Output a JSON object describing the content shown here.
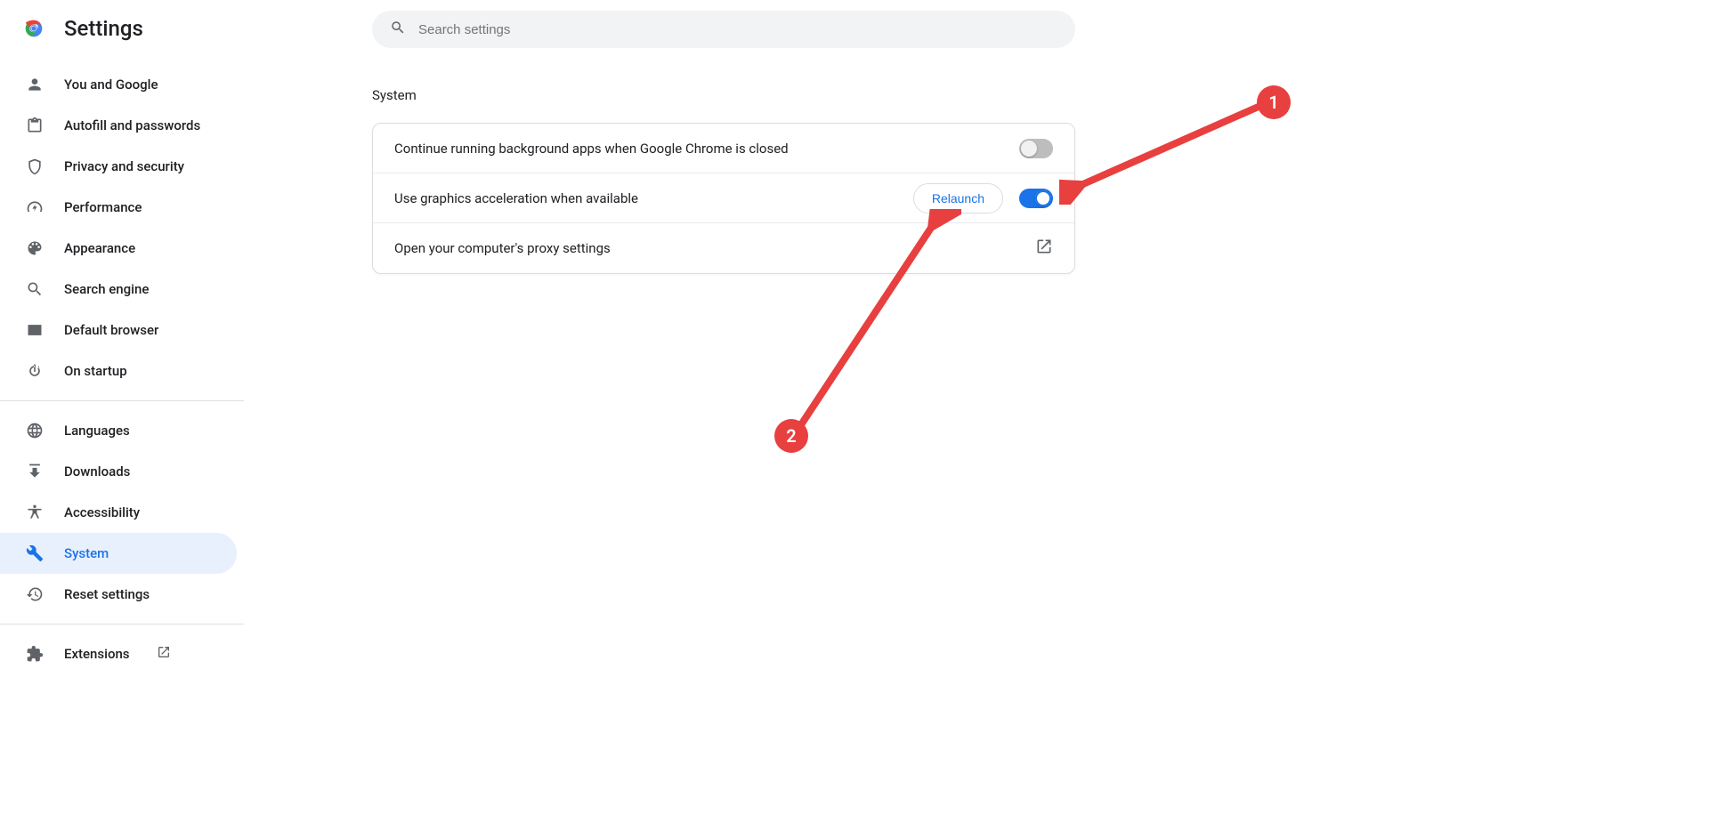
{
  "header": {
    "title": "Settings"
  },
  "search": {
    "placeholder": "Search settings"
  },
  "sidebar": {
    "items": [
      {
        "id": "you-and-google",
        "label": "You and Google",
        "icon": "person"
      },
      {
        "id": "autofill",
        "label": "Autofill and passwords",
        "icon": "clipboard"
      },
      {
        "id": "privacy",
        "label": "Privacy and security",
        "icon": "shield"
      },
      {
        "id": "performance",
        "label": "Performance",
        "icon": "speedometer"
      },
      {
        "id": "appearance",
        "label": "Appearance",
        "icon": "palette"
      },
      {
        "id": "search-engine",
        "label": "Search engine",
        "icon": "magnify"
      },
      {
        "id": "default-browser",
        "label": "Default browser",
        "icon": "browser"
      },
      {
        "id": "on-startup",
        "label": "On startup",
        "icon": "power"
      }
    ],
    "group2": [
      {
        "id": "languages",
        "label": "Languages",
        "icon": "globe"
      },
      {
        "id": "downloads",
        "label": "Downloads",
        "icon": "download"
      },
      {
        "id": "accessibility",
        "label": "Accessibility",
        "icon": "accessibility"
      },
      {
        "id": "system",
        "label": "System",
        "icon": "wrench",
        "selected": true
      },
      {
        "id": "reset",
        "label": "Reset settings",
        "icon": "history"
      }
    ],
    "group3": [
      {
        "id": "extensions",
        "label": "Extensions",
        "icon": "puzzle",
        "external": true
      }
    ]
  },
  "section": {
    "title": "System",
    "rows": [
      {
        "label": "Continue running background apps when Google Chrome is closed",
        "toggle": "off"
      },
      {
        "label": "Use graphics acceleration when available",
        "toggle": "on",
        "button": "Relaunch"
      },
      {
        "label": "Open your computer's proxy settings",
        "external": true
      }
    ]
  },
  "annotations": {
    "badge1": "1",
    "badge2": "2"
  }
}
